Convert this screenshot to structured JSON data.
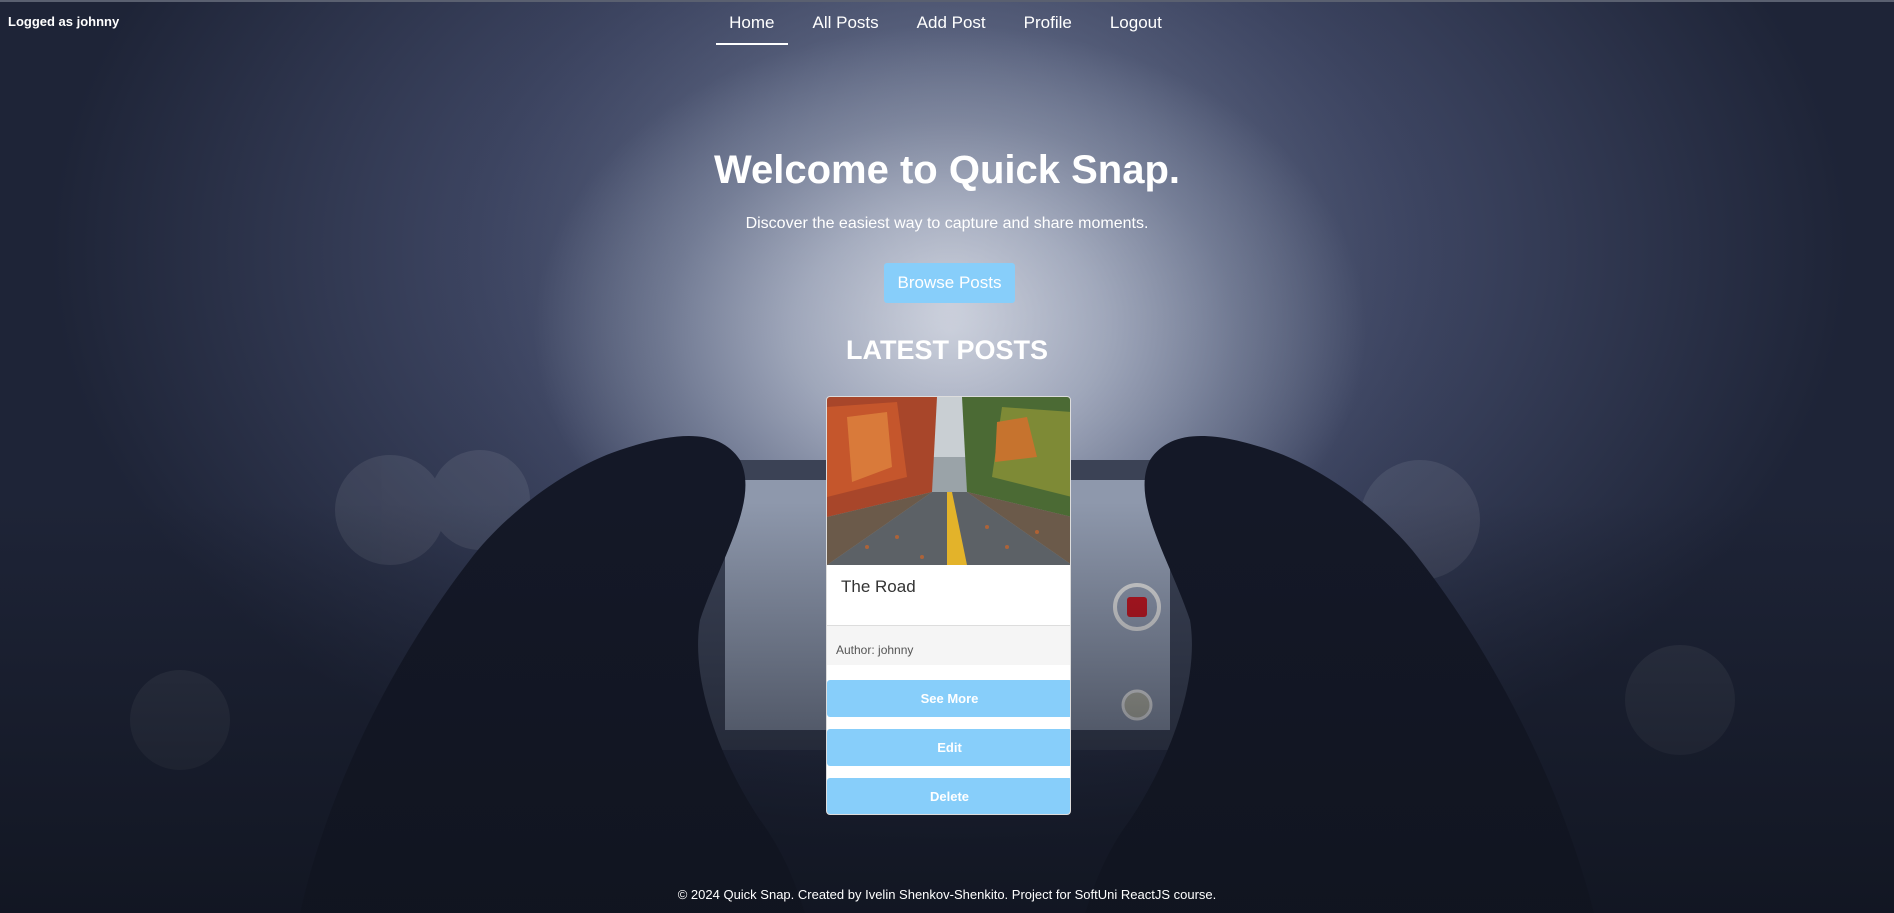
{
  "user": {
    "logged_text": "Logged as johnny"
  },
  "nav": {
    "items": [
      {
        "label": "Home",
        "active": true
      },
      {
        "label": "All Posts"
      },
      {
        "label": "Add Post"
      },
      {
        "label": "Profile"
      },
      {
        "label": "Logout"
      }
    ]
  },
  "hero": {
    "title": "Welcome to Quick Snap.",
    "subtitle": "Discover the easiest way to capture and share moments.",
    "browse_label": "Browse Posts"
  },
  "latest": {
    "heading": "LATEST POSTS",
    "posts": [
      {
        "title": "The Road",
        "author": "Author: johnny",
        "see_more_label": "See More",
        "edit_label": "Edit",
        "delete_label": "Delete"
      }
    ]
  },
  "footer": {
    "text": "© 2024 Quick Snap. Created by Ivelin Shenkov-Shenkito. Project for SoftUni ReactJS course."
  },
  "colors": {
    "accent": "#87cefa",
    "text_on_dark": "#ffffff"
  }
}
